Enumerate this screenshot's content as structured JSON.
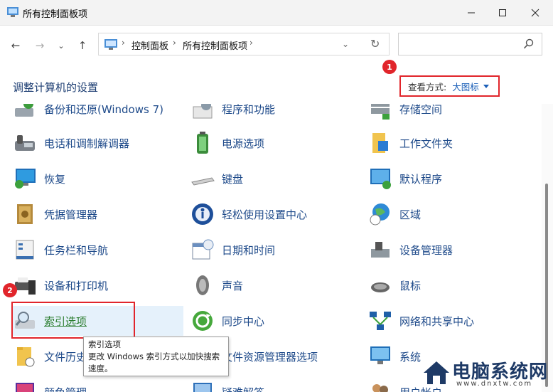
{
  "window": {
    "title": "所有控制面板项"
  },
  "address": {
    "crumbs": [
      "控制面板",
      "所有控制面板项"
    ],
    "search_placeholder": ""
  },
  "header": {
    "title": "调整计算机的设置",
    "view_by_label": "查看方式:",
    "view_by_value": "大图标"
  },
  "markers": [
    "1",
    "2"
  ],
  "items": {
    "col1": [
      "备份和还原(Windows 7)",
      "电话和调制解调器",
      "恢复",
      "凭据管理器",
      "任务栏和导航",
      "设备和打印机",
      "索引选项",
      "文件历史记录",
      "颜色管理"
    ],
    "col2": [
      "程序和功能",
      "电源选项",
      "键盘",
      "轻松使用设置中心",
      "日期和时间",
      "声音",
      "同步中心",
      "文件资源管理器选项",
      "疑难解答"
    ],
    "col3": [
      "存储空间",
      "工作文件夹",
      "默认程序",
      "区域",
      "设备管理器",
      "鼠标",
      "网络和共享中心",
      "系统",
      "用户帐户"
    ]
  },
  "tooltip": {
    "title": "索引选项",
    "body": "更改 Windows 索引方式以加快搜索速度。"
  },
  "watermark": {
    "text": "电脑系统网",
    "sub": "www.dnxtw.com"
  },
  "colors": {
    "accent": "#e1252b",
    "link": "#1e4a8a",
    "selected_bg": "#e5f1fb"
  }
}
